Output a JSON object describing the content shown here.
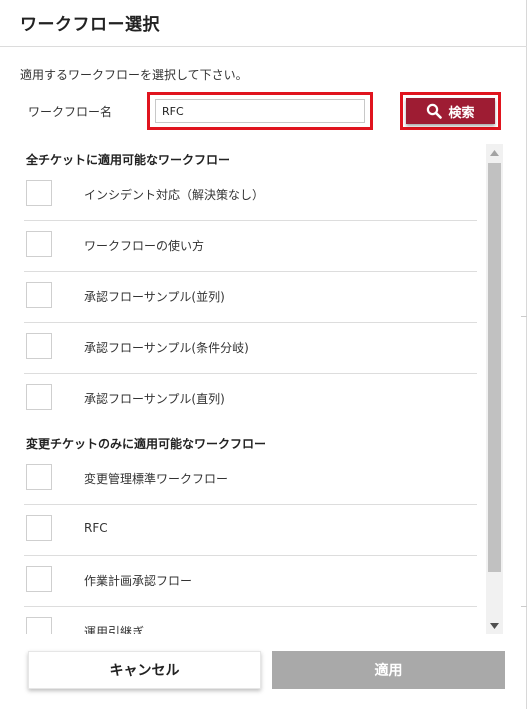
{
  "dialog": {
    "title": "ワークフロー選択"
  },
  "form": {
    "instruction": "適用するワークフローを選択して下さい。",
    "workflow_name_label": "ワークフロー名",
    "workflow_name_value": "RFC",
    "search_label": "検索"
  },
  "sections": {
    "all_header": "全チケットに適用可能なワークフロー",
    "all_items": [
      "インシデント対応（解決策なし）",
      "ワークフローの使い方",
      "承認フローサンプル(並列)",
      "承認フローサンプル(条件分岐)",
      "承認フローサンプル(直列)"
    ],
    "change_header": "変更チケットのみに適用可能なワークフロー",
    "change_items": [
      "変更管理標準ワークフロー",
      "RFC",
      "作業計画承認フロー",
      "運用引継ぎ"
    ]
  },
  "footer": {
    "cancel_label": "キャンセル",
    "apply_label": "適用"
  },
  "colors": {
    "search_button": "#9e1c33",
    "highlight_border": "#e0141e",
    "apply_disabled": "#a9a9a9"
  },
  "icons": {
    "search": "search-icon",
    "scroll_up": "arrow-up-icon",
    "scroll_down": "arrow-down-icon"
  }
}
